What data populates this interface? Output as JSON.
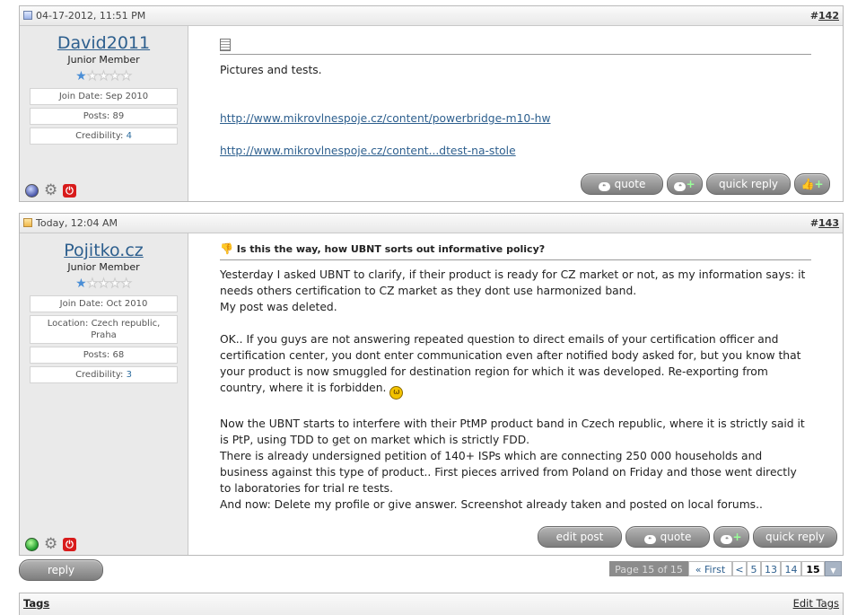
{
  "posts": [
    {
      "date": "04-17-2012, 11:51 PM",
      "number_prefix": "#",
      "number": "142",
      "username": "David2011",
      "user_title": "Junior Member",
      "stars_total": 5,
      "stars_on": 1,
      "info": [
        {
          "label": "Join Date: ",
          "value": "Sep 2010"
        },
        {
          "label": "Posts: ",
          "value": "89"
        },
        {
          "label": "Credibility: ",
          "value": "4"
        }
      ],
      "online": false,
      "title": "",
      "message_lines": [
        "Pictures and tests."
      ],
      "links": [
        "http://www.mikrovlnespoje.cz/content/powerbridge-m10-hw",
        "http://www.mikrovlnespoje.cz/content...dtest-na-stole"
      ],
      "buttons": [
        "quote",
        "",
        "quick reply",
        ""
      ]
    },
    {
      "date": "Today, 12:04 AM",
      "number_prefix": "#",
      "number": "143",
      "username": "Pojitko.cz",
      "user_title": "Junior Member",
      "stars_total": 5,
      "stars_on": 1,
      "info": [
        {
          "label": "Join Date: ",
          "value": "Oct 2010"
        },
        {
          "label": "Location: ",
          "value": "Czech republic, Praha"
        },
        {
          "label": "Posts: ",
          "value": "68"
        },
        {
          "label": "Credibility: ",
          "value": "3"
        }
      ],
      "online": true,
      "title": "Is this the way, how UBNT sorts out informative policy?",
      "paragraphs": [
        "Yesterday I asked UBNT to clarify, if their product is ready for CZ market or not, as my information says: it needs others certification to CZ market as they dont use harmonized band.",
        "My post was deleted.",
        "",
        "OK.. If you guys are not answering repeated question to direct emails of your certification officer and certification center, you dont enter communication even after notified body asked for, but you know that your product is now smuggled for destination region for which it was developed. Re-exporting from country, where it is forbidden.",
        "",
        "Now the UBNT starts to interfere with their PtMP product band in Czech republic, where it is strictly said it is PtP, using TDD to get on market which is strictly FDD.",
        "There is already undersigned petition of 140+ ISPs which are connecting 250 000 households and business against this type of product.. First pieces arrived from Poland on Friday and those went directly to laboratories for trial re tests.",
        "And now: Delete my profile or give answer. Screenshot already taken and posted on local forums.."
      ],
      "buttons": [
        "edit post",
        "quote",
        "",
        "quick reply"
      ]
    }
  ],
  "reply_button": "reply",
  "pagination": {
    "summary": "Page 15 of 15",
    "first": "« First",
    "prev": "<",
    "pages": [
      "5",
      "13",
      "14"
    ],
    "current": "15"
  },
  "tags": {
    "label": "Tags",
    "edit": "Edit Tags"
  },
  "colors": {
    "link": "#2d5f8e",
    "button": "#8a8a8a",
    "sidebar": "#eaeaea"
  }
}
